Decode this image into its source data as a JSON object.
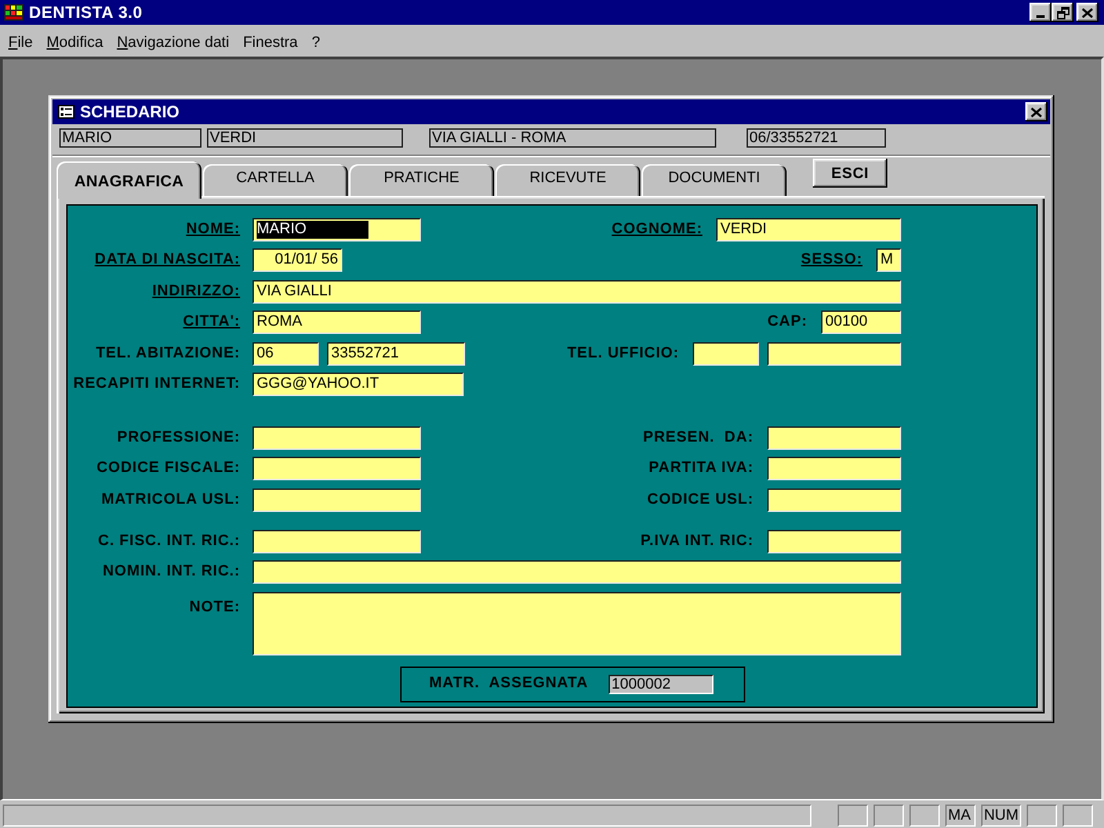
{
  "window": {
    "title": "DENTISTA 3.0"
  },
  "menu_bar": [
    {
      "label": "File",
      "mnemonic": true
    },
    {
      "label": "Modifica",
      "mnemonic": true
    },
    {
      "label": "Navigazione dati",
      "mnemonic": true
    },
    {
      "label": "Finestra",
      "mnemonic": false
    },
    {
      "label": "?",
      "mnemonic": false
    }
  ],
  "child_window": {
    "title": "SCHEDARIO",
    "summary_fields": [
      "MARIO",
      "VERDI",
      "VIA GIALLI - ROMA",
      "06/33552721"
    ],
    "tabs": [
      {
        "label": "ANAGRAFICA",
        "selected": true
      },
      {
        "label": "CARTELLA",
        "selected": false
      },
      {
        "label": "PRATICHE",
        "selected": false
      },
      {
        "label": "RICEVUTE",
        "selected": false
      },
      {
        "label": "DOCUMENTI",
        "selected": false
      }
    ],
    "exit_button": "ESCI",
    "form": {
      "sections": [
        {
          "rows": [
            {
              "fields": [
                {
                  "label": "NOME:",
                  "underlined": true,
                  "inputs": [
                    {
                      "value": "MARIO",
                      "text_selected": true
                    }
                  ]
                },
                {
                  "label": "COGNOME:",
                  "underlined": true,
                  "inputs": [
                    {
                      "value": "VERDI",
                      "text_selected": false
                    }
                  ]
                }
              ]
            },
            {
              "fields": [
                {
                  "label": "DATA DI NASCITA:",
                  "underlined": true,
                  "inputs": [
                    {
                      "value": "01/01/ 56",
                      "text_selected": false
                    }
                  ]
                },
                {
                  "label": "SESSO:",
                  "underlined": true,
                  "inputs": [
                    {
                      "value": "M",
                      "text_selected": false
                    }
                  ]
                }
              ]
            },
            {
              "fields": [
                {
                  "label": "INDIRIZZO:",
                  "underlined": true,
                  "inputs": [
                    {
                      "value": "VIA GIALLI",
                      "text_selected": false
                    }
                  ]
                }
              ]
            },
            {
              "fields": [
                {
                  "label": "CITTA':",
                  "underlined": true,
                  "inputs": [
                    {
                      "value": "ROMA",
                      "text_selected": false
                    }
                  ]
                },
                {
                  "label": "CAP:",
                  "underlined": false,
                  "inputs": [
                    {
                      "value": "00100",
                      "text_selected": false
                    }
                  ]
                }
              ]
            },
            {
              "fields": [
                {
                  "label": "TEL. ABITAZIONE:",
                  "underlined": false,
                  "inputs": [
                    {
                      "value": "06",
                      "text_selected": false
                    },
                    {
                      "value": "33552721",
                      "text_selected": false
                    }
                  ]
                },
                {
                  "label": "TEL. UFFICIO:",
                  "underlined": false,
                  "inputs": [
                    {
                      "text_selected": false
                    },
                    {
                      "text_selected": false
                    }
                  ]
                }
              ]
            },
            {
              "fields": [
                {
                  "label": "RECAPITI INTERNET:",
                  "underlined": false,
                  "inputs": [
                    {
                      "value": "GGG@YAHOO.IT",
                      "text_selected": false
                    }
                  ]
                }
              ]
            }
          ]
        },
        {
          "rows": [
            {
              "fields": [
                {
                  "label": "PROFESSIONE:",
                  "underlined": false,
                  "inputs": [
                    {
                      "text_selected": false
                    }
                  ]
                },
                {
                  "label": "PRESEN.  DA:",
                  "underlined": false,
                  "inputs": [
                    {
                      "text_selected": false
                    }
                  ]
                }
              ]
            },
            {
              "fields": [
                {
                  "label": "CODICE FISCALE:",
                  "underlined": false,
                  "inputs": [
                    {
                      "text_selected": false
                    }
                  ]
                },
                {
                  "label": "PARTITA IVA:",
                  "underlined": false,
                  "inputs": [
                    {
                      "text_selected": false
                    }
                  ]
                }
              ]
            },
            {
              "fields": [
                {
                  "label": "MATRICOLA USL:",
                  "underlined": false,
                  "inputs": [
                    {
                      "text_selected": false
                    }
                  ]
                },
                {
                  "label": "CODICE USL:",
                  "underlined": false,
                  "inputs": [
                    {
                      "text_selected": false
                    }
                  ]
                }
              ]
            }
          ]
        },
        {
          "rows": [
            {
              "fields": [
                {
                  "label": "C. FISC. INT. RIC.:",
                  "underlined": false,
                  "inputs": [
                    {
                      "text_selected": false
                    }
                  ]
                },
                {
                  "label": "P.IVA INT. RIC:",
                  "underlined": false,
                  "inputs": [
                    {
                      "text_selected": false
                    }
                  ]
                }
              ]
            },
            {
              "fields": [
                {
                  "label": "NOMIN. INT. RIC.:",
                  "underlined": false,
                  "inputs": [
                    {
                      "text_selected": false
                    }
                  ]
                }
              ]
            },
            {
              "fields": [
                {
                  "label": "NOTE:",
                  "underlined": false,
                  "inputs": [
                    {
                      "text_selected": false
                    }
                  ]
                }
              ]
            }
          ]
        }
      ],
      "assigned_number": {
        "label": "MATR.  ASSEGNATA",
        "value": "1000002"
      }
    }
  },
  "status_bar": {
    "panels": [
      {
        "kind": "message"
      },
      {
        "kind": "indicator"
      },
      {
        "kind": "indicator"
      },
      {
        "kind": "indicator"
      },
      {
        "kind": "indicator",
        "text": "MA"
      },
      {
        "kind": "indicator",
        "text": "NUM"
      },
      {
        "kind": "indicator"
      },
      {
        "kind": "indicator"
      }
    ]
  }
}
